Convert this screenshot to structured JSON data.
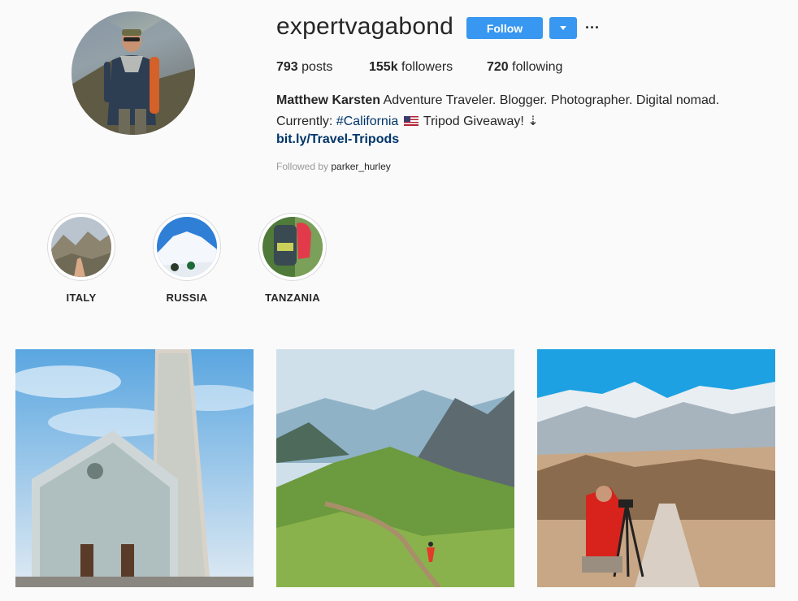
{
  "profile": {
    "username": "expertvagabond",
    "follow_label": "Follow",
    "more_label": "···"
  },
  "stats": {
    "posts_count": "793",
    "posts_label": "posts",
    "followers_count": "155k",
    "followers_label": "followers",
    "following_count": "720",
    "following_label": "following"
  },
  "bio": {
    "name": "Matthew Karsten",
    "line1_rest": " Adventure Traveler. Blogger. Photographer. Digital nomad.",
    "line2_prefix": "Currently: ",
    "hashtag": "#California",
    "line2_suffix": " Tripod Giveaway! ⇣",
    "link": "bit.ly/Travel-Tripods",
    "followed_by_prefix": "Followed by",
    "followed_by_user": "parker_hurley"
  },
  "highlights": [
    {
      "label": "ITALY"
    },
    {
      "label": "RUSSIA"
    },
    {
      "label": "TANZANIA"
    }
  ],
  "colors": {
    "accent": "#3897f0",
    "link": "#003569",
    "background": "#fafafa"
  }
}
